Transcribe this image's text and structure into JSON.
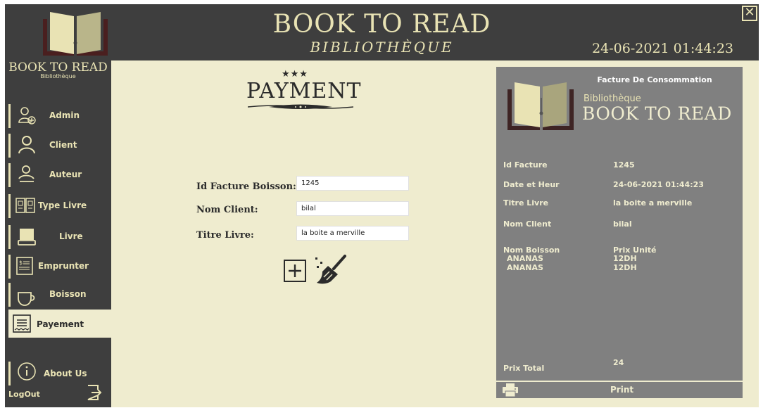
{
  "header": {
    "title": "BOOK TO READ",
    "subtitle": "BIBLIOTHÈQUE",
    "datetime": "24-06-2021 01:44:23",
    "close_glyph": "✕"
  },
  "sidebar": {
    "brand_title": "BOOK TO READ",
    "brand_subtitle": "Bibliothèque",
    "items": [
      {
        "label": "Admin",
        "icon": "add-user-icon"
      },
      {
        "label": "Client",
        "icon": "user-icon"
      },
      {
        "label": "Auteur",
        "icon": "author-icon"
      },
      {
        "label": "Type Livre",
        "icon": "book-type-icon"
      },
      {
        "label": "Livre",
        "icon": "book-icon"
      },
      {
        "label": "Emprunter",
        "icon": "borrow-icon"
      },
      {
        "label": "Boisson",
        "icon": "cup-icon"
      },
      {
        "label": "Payement",
        "icon": "receipt-icon",
        "active": true
      },
      {
        "label": "About Us",
        "icon": "info-icon"
      }
    ],
    "logout_label": "LogOut"
  },
  "payment": {
    "stars": "★★★",
    "title": "PAYMENT",
    "fields": [
      {
        "label": "Id Facture Boisson:",
        "value": "1245"
      },
      {
        "label": "Nom Client:",
        "value": "bilal"
      },
      {
        "label": "Titre Livre:",
        "value": "la boite a merville"
      }
    ]
  },
  "invoice": {
    "title": "Facture De Consommation",
    "brand_sub": "Bibliothèque",
    "brand": "BOOK TO READ",
    "rows": [
      {
        "key": "Id Facture",
        "value": "1245"
      },
      {
        "key": "Date et Heur",
        "value": "24-06-2021 01:44:23"
      },
      {
        "key": "Titre Livre",
        "value": "la boite a merville"
      },
      {
        "key": "Nom Client",
        "value": "bilal"
      }
    ],
    "items_header": {
      "name": "Nom Boisson",
      "price": "Prix Unité"
    },
    "items": [
      {
        "name": "ANANAS",
        "price": "12DH"
      },
      {
        "name": "ANANAS",
        "price": "12DH"
      }
    ],
    "total_label": "Prix Total",
    "total_value": "24"
  },
  "print": {
    "label": "Print"
  },
  "colors": {
    "dark": "#3e3e3e",
    "cream": "#efeccf",
    "accent": "#e9e3b4",
    "panel": "#808080"
  }
}
